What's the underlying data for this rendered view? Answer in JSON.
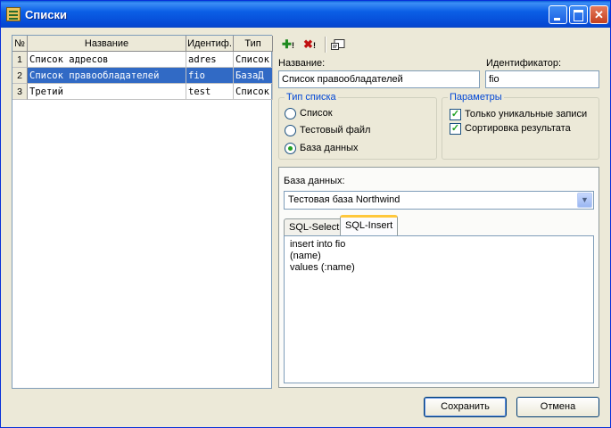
{
  "window": {
    "title": "Списки"
  },
  "table": {
    "headers": [
      "№",
      "Название",
      "Идентиф.",
      "Тип"
    ],
    "rows": [
      {
        "num": "1",
        "name": "Список адресов",
        "id": "adres",
        "type": "Список"
      },
      {
        "num": "2",
        "name": "Список правообладателей",
        "id": "fio",
        "type": "БазаД"
      },
      {
        "num": "3",
        "name": "Третий",
        "id": "test",
        "type": "Список"
      }
    ]
  },
  "form": {
    "name_label": "Название:",
    "name_value": "Список правообладателей",
    "id_label": "Идентификатор:",
    "id_value": "fio"
  },
  "list_type": {
    "title": "Тип списка",
    "options": [
      "Список",
      "Тестовый файл",
      "База данных"
    ],
    "selected": "База данных"
  },
  "params": {
    "title": "Параметры",
    "options": [
      "Только уникальные записи",
      "Сортировка результата"
    ]
  },
  "database": {
    "label": "База данных:",
    "selected": "Тестовая база Northwind",
    "tabs": [
      "SQL-Select",
      "SQL-Insert"
    ],
    "active_tab": "SQL-Insert",
    "sql_lines": [
      "insert into fio",
      "(name)",
      "values (:name)"
    ]
  },
  "buttons": {
    "save": "Сохранить",
    "cancel": "Отмена"
  }
}
